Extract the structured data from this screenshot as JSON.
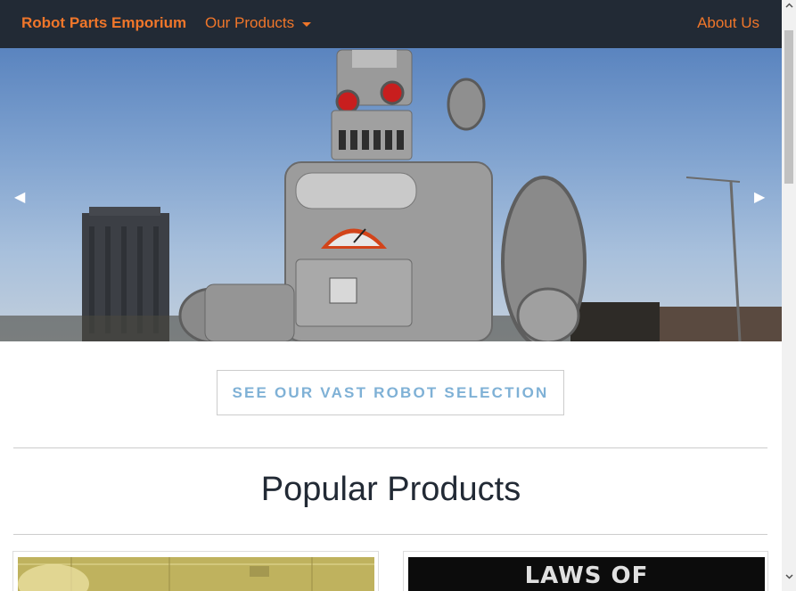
{
  "navbar": {
    "brand": "Robot Parts Emporium",
    "products_label": "Our Products",
    "about_label": "About Us"
  },
  "hero": {
    "prev_glyph": "◀",
    "next_glyph": "▶"
  },
  "cta": {
    "label": "SEE OUR VAST ROBOT SELECTION"
  },
  "popular": {
    "title": "Popular Products",
    "cards": [
      {
        "image_text": ""
      },
      {
        "image_text": "LAWS OF"
      }
    ]
  },
  "colors": {
    "nav_bg": "#222a35",
    "accent": "#f0762a",
    "cta_text": "#7fb1d6"
  },
  "icons": {
    "dropdown": "caret-down-icon",
    "prev": "chevron-left-icon",
    "next": "chevron-right-icon"
  }
}
